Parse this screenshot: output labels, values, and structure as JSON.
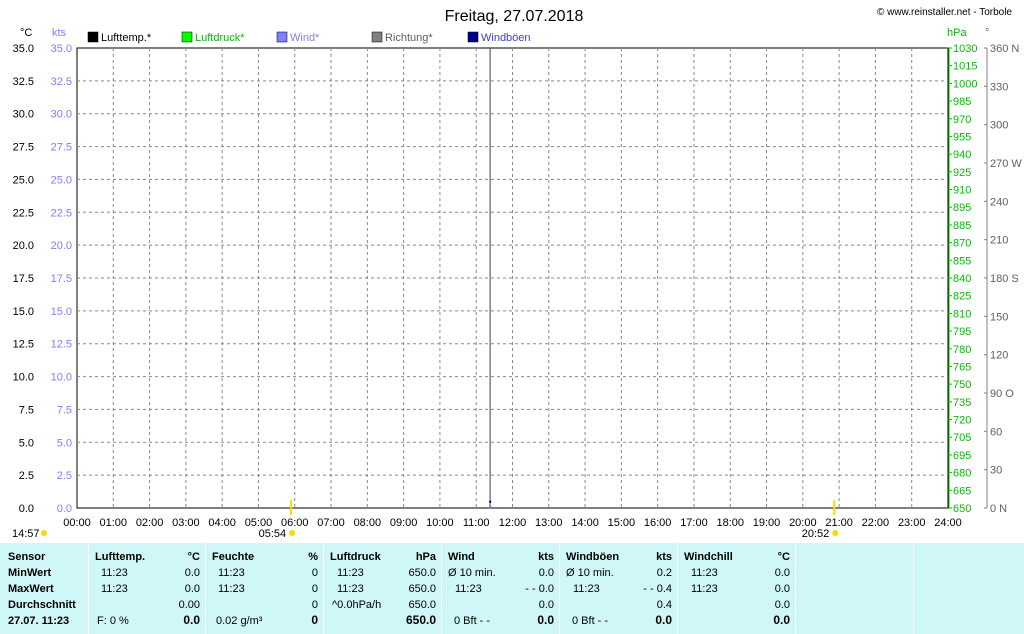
{
  "header": {
    "title": "Freitag, 27.07.2018",
    "credit": "© www.reinstaller.net - Torbole"
  },
  "legend": [
    {
      "label": "Lufttemp.*",
      "swatch": "#000000",
      "text_color": "#000000"
    },
    {
      "label": "Luftdruck*",
      "swatch": "#00ff00",
      "text_color": "#00c000"
    },
    {
      "label": "Wind*",
      "swatch": "#7f7fff",
      "text_color": "#7f7fff"
    },
    {
      "label": "Richtung*",
      "swatch": "#808080",
      "text_color": "#606060"
    },
    {
      "label": "Windböen",
      "swatch": "#00008b",
      "text_color": "#3f3fbf"
    }
  ],
  "chart_data": {
    "type": "line",
    "title": "Freitag, 27.07.2018",
    "x_ticks": [
      "00:00",
      "01:00",
      "02:00",
      "03:00",
      "04:00",
      "05:00",
      "06:00",
      "07:00",
      "08:00",
      "09:00",
      "10:00",
      "11:00",
      "12:00",
      "13:00",
      "14:00",
      "15:00",
      "16:00",
      "17:00",
      "18:00",
      "19:00",
      "20:00",
      "21:00",
      "22:00",
      "23:00",
      "24:00"
    ],
    "xlim_hours": [
      0,
      24
    ],
    "current_time_hours": 11.383,
    "sunrise": {
      "label": "05:54",
      "hours": 5.9
    },
    "sunset": {
      "label": "20:52",
      "hours": 20.867
    },
    "corner_time_label": "14:57",
    "axes": {
      "temp": {
        "unit": "°C",
        "min": 0,
        "max": 35,
        "step": 2.5,
        "color": "#000000",
        "ticks": [
          "0.0",
          "2.5",
          "5.0",
          "7.5",
          "10.0",
          "12.5",
          "15.0",
          "17.5",
          "20.0",
          "22.5",
          "25.0",
          "27.5",
          "30.0",
          "32.5",
          "35.0"
        ]
      },
      "wind": {
        "unit": "kts",
        "min": 0,
        "max": 35,
        "step": 2.5,
        "color": "#7f7fff",
        "ticks": [
          "0.0",
          "2.5",
          "5.0",
          "7.5",
          "10.0",
          "12.5",
          "15.0",
          "17.5",
          "20.0",
          "22.5",
          "25.0",
          "27.5",
          "30.0",
          "32.5",
          "35.0"
        ]
      },
      "pressure": {
        "unit": "hPa",
        "min": 650,
        "max": 1030,
        "color": "#00c000",
        "ticks": [
          "650",
          "665",
          "680",
          "695",
          "705",
          "720",
          "735",
          "750",
          "765",
          "780",
          "795",
          "810",
          "825",
          "840",
          "855",
          "870",
          "885",
          "895",
          "910",
          "925",
          "940",
          "955",
          "970",
          "985",
          "1000",
          "1015",
          "1030"
        ]
      },
      "direction": {
        "unit": "°",
        "min": 0,
        "max": 360,
        "step": 30,
        "color": "#606060",
        "ticks": [
          "0 N",
          "30",
          "60",
          "90 O",
          "120",
          "150",
          "180 S",
          "210",
          "240",
          "270 W",
          "300",
          "330",
          "360 N"
        ]
      }
    },
    "grid": true,
    "series": [
      {
        "name": "Lufttemp.*",
        "color": "#000000",
        "points": [
          [
            11.383,
            0.0
          ]
        ]
      },
      {
        "name": "Luftdruck*",
        "color": "#00ff00",
        "points": [
          [
            11.383,
            650.0
          ]
        ]
      },
      {
        "name": "Wind*",
        "color": "#7f7fff",
        "points": [
          [
            11.383,
            0.0
          ]
        ]
      },
      {
        "name": "Richtung*",
        "color": "#808080",
        "points": []
      },
      {
        "name": "Windböen",
        "color": "#00008b",
        "points": [
          [
            11.383,
            0.4
          ]
        ]
      }
    ]
  },
  "summary": {
    "sensor": {
      "header": "Sensor",
      "rows": [
        "MinWert",
        "MaxWert",
        "Durchschnitt",
        "27.07. 11:23"
      ]
    },
    "temp": {
      "header": "Lufttemp.",
      "unit": "°C",
      "min_time": "11:23",
      "min_val": "0.0",
      "max_time": "11:23",
      "max_val": "0.0",
      "avg_val": "0.00",
      "cur_left": "F: 0 %",
      "cur_val": "0.0"
    },
    "humidity": {
      "header": "Feuchte",
      "unit": "%",
      "min_time": "11:23",
      "min_val": "0",
      "max_time": "11:23",
      "max_val": "0",
      "avg_val": "0",
      "cur_left": "0.02 g/m³",
      "cur_val": "0"
    },
    "pressure": {
      "header": "Luftdruck",
      "unit": "hPa",
      "min_time": "11:23",
      "min_val": "650.0",
      "max_time": "11:23",
      "max_val": "650.0",
      "avg_left": "^0.0hPa/h",
      "avg_val": "650.0",
      "cur_val": "650.0"
    },
    "wind": {
      "header": "Wind",
      "unit": "kts",
      "min_label": "Ø 10 min.",
      "min_val": "0.0",
      "max_time": "11:23",
      "max_val": "- - 0.0",
      "avg_val": "0.0",
      "cur_left": "0 Bft - -",
      "cur_val": "0.0"
    },
    "gusts": {
      "header": "Windböen",
      "unit": "kts",
      "min_label": "Ø 10 min.",
      "min_val": "0.2",
      "max_time": "11:23",
      "max_val": "- - 0.4",
      "avg_val": "0.4",
      "cur_left": "0 Bft - -",
      "cur_val": "0.0"
    },
    "windchill": {
      "header": "Windchill",
      "unit": "°C",
      "min_time": "11:23",
      "min_val": "0.0",
      "max_time": "11:23",
      "max_val": "0.0",
      "avg_val": "0.0",
      "cur_val": "0.0"
    }
  }
}
